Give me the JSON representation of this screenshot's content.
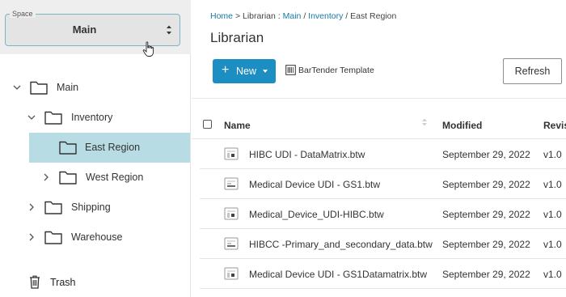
{
  "sidebar": {
    "space": {
      "legend": "Space",
      "value": "Main"
    },
    "tree": [
      {
        "label": "Main",
        "expanded": true,
        "selected": false
      },
      {
        "label": "Inventory",
        "expanded": true,
        "selected": false
      },
      {
        "label": "East Region",
        "expanded": false,
        "selected": true
      },
      {
        "label": "West Region",
        "expanded": false,
        "selected": false
      },
      {
        "label": "Shipping",
        "expanded": false,
        "selected": false
      },
      {
        "label": "Warehouse",
        "expanded": false,
        "selected": false
      }
    ],
    "trash_label": "Trash"
  },
  "breadcrumb": {
    "home": "Home",
    "sep1": ">",
    "librarian": "Librarian",
    "sep2": ":",
    "main": "Main",
    "sep3": "/",
    "inventory": "Inventory",
    "sep4": "/",
    "current": "East Region"
  },
  "page_title": "Librarian",
  "toolbar": {
    "new_label": "New",
    "template_label": "BarTender Template",
    "refresh_label": "Refresh"
  },
  "table": {
    "columns": {
      "name": "Name",
      "modified": "Modified",
      "revision": "Revis"
    },
    "rows": [
      {
        "name": "HIBC UDI - DataMatrix.btw",
        "modified": "September 29, 2022",
        "revision": "v1.0"
      },
      {
        "name": "Medical Device UDI - GS1.btw",
        "modified": "September 29, 2022",
        "revision": "v1.0"
      },
      {
        "name": "Medical_Device_UDI-HIBC.btw",
        "modified": "September 29, 2022",
        "revision": "v1.0"
      },
      {
        "name": "HIBCC -Primary_and_secondary_data.btw",
        "modified": "September 29, 2022",
        "revision": "v1.0"
      },
      {
        "name": "Medical Device UDI - GS1Datamatrix.btw",
        "modified": "September 29, 2022",
        "revision": "v1.0"
      }
    ]
  },
  "colors": {
    "accent": "#1d8ec1",
    "link": "#1479a6",
    "selected_row": "#b8dce4"
  }
}
